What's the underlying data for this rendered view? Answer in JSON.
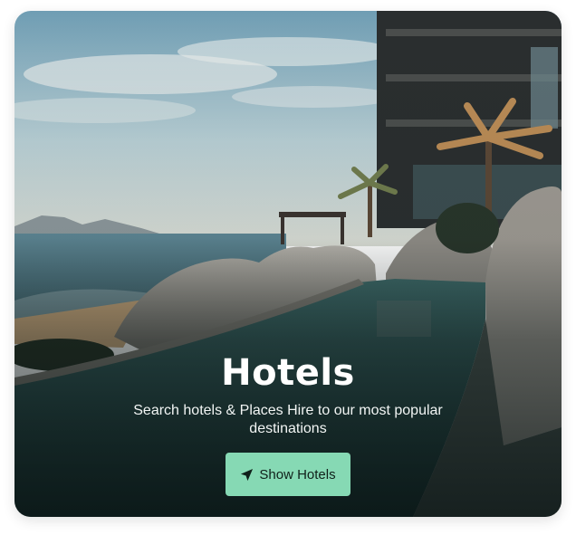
{
  "card": {
    "title": "Hotels",
    "subtitle": "Search hotels & Places Hire to our most popular destinations",
    "button_label": "Show Hotels",
    "button_icon": "paper-plane-icon"
  },
  "colors": {
    "button_bg": "#86d9b4",
    "text": "#ffffff"
  }
}
